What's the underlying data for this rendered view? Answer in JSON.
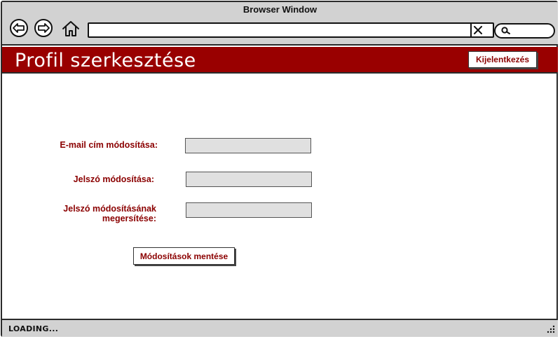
{
  "window": {
    "title": "Browser Window",
    "url": "",
    "search": ""
  },
  "header": {
    "title": "Profil szerkesztése",
    "logout_label": "Kijelentkezés",
    "color": "#990000"
  },
  "form": {
    "email_label": "E-mail cím módosítása:",
    "password_label": "Jelszó módosítása:",
    "password_confirm_label": "Jelszó módosításának megersítése:",
    "save_label": "Módosítások mentése"
  },
  "status": {
    "text": "LOADING..."
  },
  "icons": [
    "back-icon",
    "forward-icon",
    "home-icon",
    "clear-icon",
    "search-icon",
    "resize-grip-icon"
  ]
}
